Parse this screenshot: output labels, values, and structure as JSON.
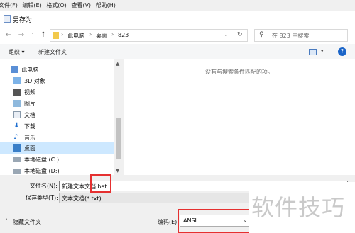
{
  "menubar": {
    "items": [
      "文件(F)",
      "编辑(E)",
      "格式(O)",
      "查看(V)",
      "帮助(H)"
    ]
  },
  "window": {
    "title": "另存为"
  },
  "nav": {
    "back_icon": "arrow-left-icon",
    "forward_icon": "arrow-right-icon",
    "breadcrumb": [
      "此电脑",
      "桌面",
      "823"
    ],
    "search_placeholder": "在 823 中搜索"
  },
  "toolbar": {
    "organize": "组织 ▾",
    "new_folder": "新建文件夹"
  },
  "sidebar": {
    "items": [
      {
        "label": "此电脑",
        "icon": "pc-icon"
      },
      {
        "label": "3D 对象",
        "icon": "cube-icon"
      },
      {
        "label": "视频",
        "icon": "video-icon"
      },
      {
        "label": "图片",
        "icon": "pictures-icon"
      },
      {
        "label": "文档",
        "icon": "documents-icon"
      },
      {
        "label": "下载",
        "icon": "download-icon"
      },
      {
        "label": "音乐",
        "icon": "music-icon"
      },
      {
        "label": "桌面",
        "icon": "desktop-icon",
        "selected": true
      },
      {
        "label": "本地磁盘 (C:)",
        "icon": "drive-icon"
      },
      {
        "label": "本地磁盘 (D:)",
        "icon": "drive-icon"
      }
    ]
  },
  "content": {
    "empty_message": "没有与搜索条件匹配的项。"
  },
  "form": {
    "filename_label": "文件名(N):",
    "filename_value": "新建文本文档.bat",
    "filetype_label": "保存类型(T):",
    "filetype_value": "文本文档(*.txt)",
    "hide_folders": "隐藏文件夹",
    "encoding_label": "编码(E):",
    "encoding_value": "ANSI"
  },
  "watermark": {
    "text": "软件技巧"
  },
  "colors": {
    "selection": "#cde8ff",
    "highlight_box": "#e53030",
    "accent": "#1a64c8"
  }
}
